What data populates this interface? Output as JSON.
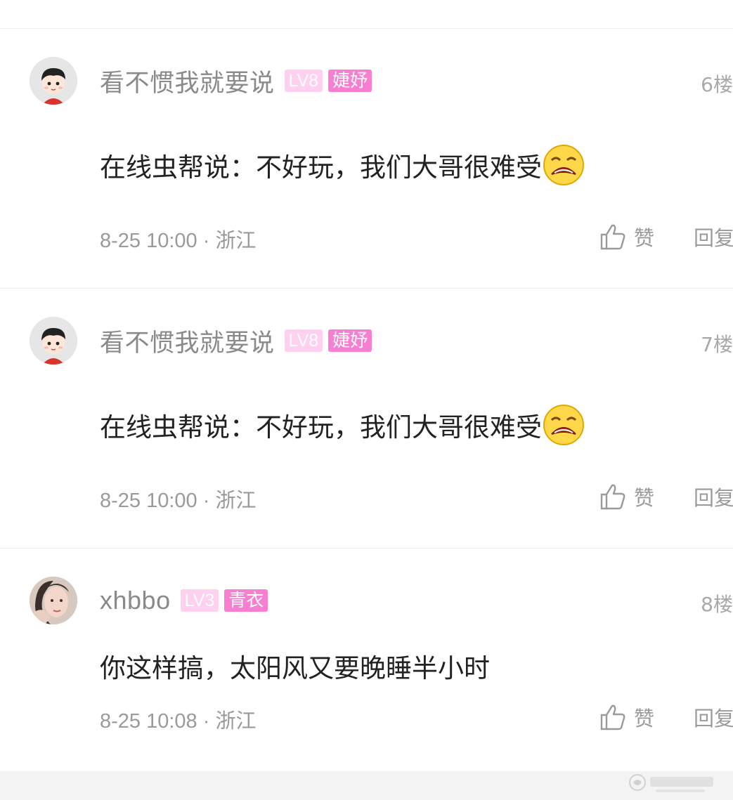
{
  "comments": [
    {
      "username": "看不惯我就要说",
      "level": "LV8",
      "title_badge": "婕妤",
      "floor": "6楼",
      "content": "在线虫帮说：不好玩，我们大哥很难受",
      "emoji": "crying-emoji",
      "meta": "8-25 10:00 · 浙江",
      "like_label": "赞",
      "reply_label": "回复",
      "avatar": "cartoon-boy-avatar"
    },
    {
      "username": "看不惯我就要说",
      "level": "LV8",
      "title_badge": "婕妤",
      "floor": "7楼",
      "content": "在线虫帮说：不好玩，我们大哥很难受",
      "emoji": "crying-emoji",
      "meta": "8-25 10:00 · 浙江",
      "like_label": "赞",
      "reply_label": "回复",
      "avatar": "cartoon-boy-avatar"
    },
    {
      "username": "xhbbo",
      "level": "LV3",
      "title_badge": "青衣",
      "floor": "8楼",
      "content": "你这样搞，太阳风又要晚睡半小时",
      "meta": "8-25 10:08 · 浙江",
      "like_label": "赞",
      "reply_label": "回复",
      "avatar": "photo-avatar"
    }
  ],
  "colors": {
    "level_badge": "#ffd0ef",
    "title_badge": "#f77ed0",
    "username": "#8a8a8a",
    "content": "#222222",
    "meta": "#9a9a9a"
  }
}
